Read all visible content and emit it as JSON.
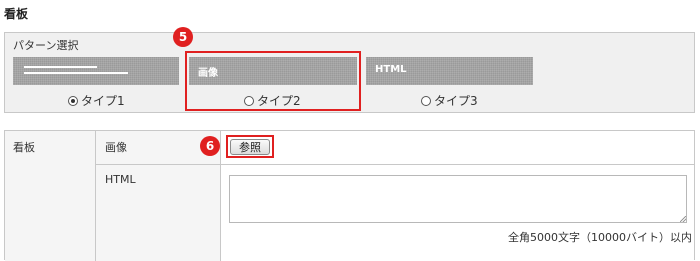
{
  "section_title": "看板",
  "pattern": {
    "label": "パターン選択",
    "options": [
      {
        "thumb_text": "",
        "label": "タイプ1",
        "selected": true
      },
      {
        "thumb_text": "画像",
        "label": "タイプ2",
        "selected": false
      },
      {
        "thumb_text": "HTML",
        "label": "タイプ3",
        "selected": false
      }
    ]
  },
  "annotations": {
    "marker5": "5",
    "marker6": "6",
    "highlight_color": "#e02020"
  },
  "form": {
    "row_label": "看板",
    "image_label": "画像",
    "browse_button": "参照",
    "html_label": "HTML",
    "html_value": "",
    "limit_note": "全角5000文字（10000バイト）以内"
  }
}
